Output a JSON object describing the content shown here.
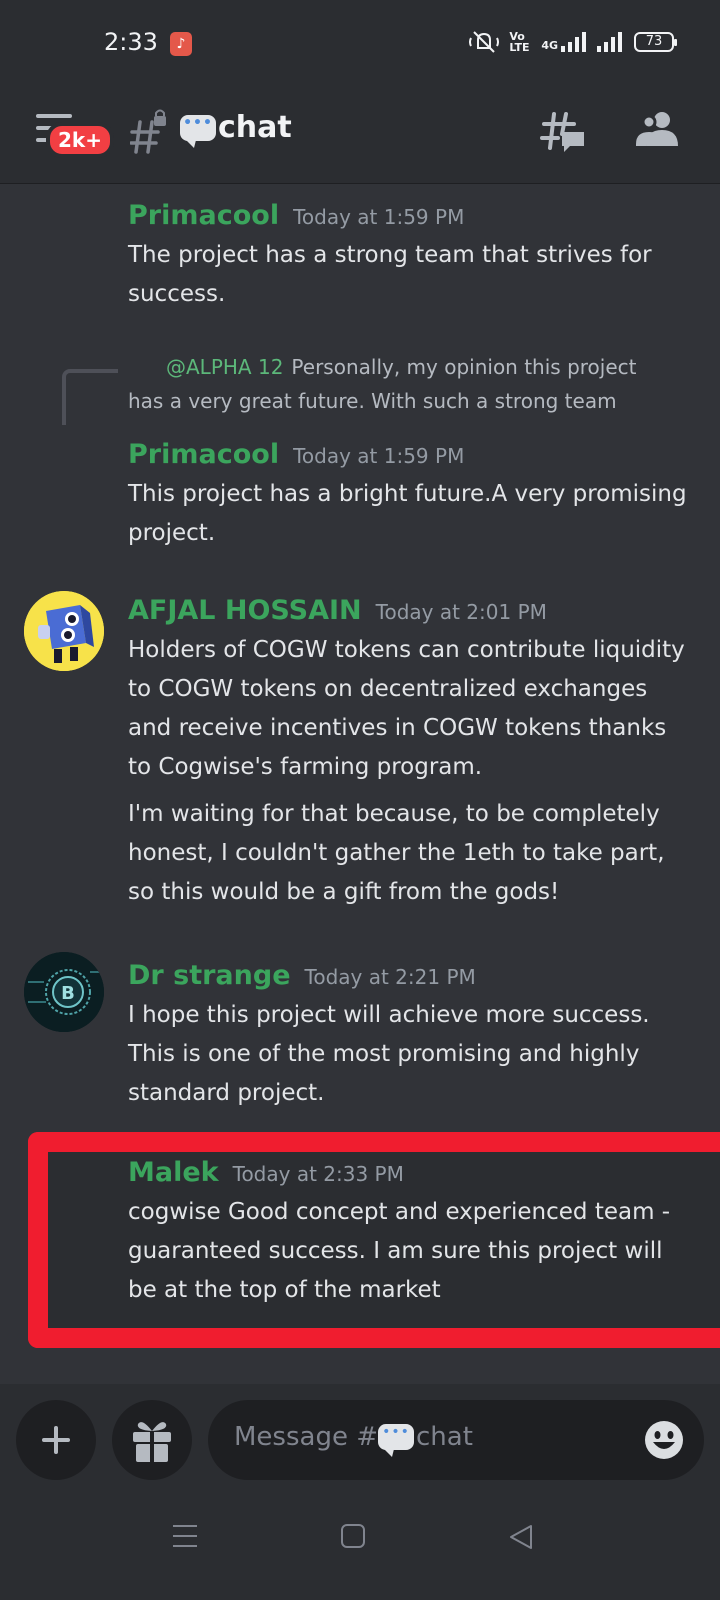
{
  "status_bar": {
    "time": "2:33",
    "network": "4G",
    "volte": "Vo LTE",
    "battery": "73"
  },
  "header": {
    "notification_badge": "2k+",
    "channel_name": "chat"
  },
  "messages": [
    {
      "author": "Primacool",
      "timestamp": "Today at 1:59 PM",
      "text": "The project has a strong team that strives for success."
    },
    {
      "reply_mention": "@ALPHA 12",
      "reply_text_line1": "Personally, my opinion this project",
      "reply_text_line2": "has a very great future. With such a strong team",
      "author": "Primacool",
      "timestamp": "Today at 1:59 PM",
      "text": "This project has a bright future.A very promising project."
    },
    {
      "author": "AFJAL HOSSAIN",
      "timestamp": "Today at 2:01 PM",
      "text": "Holders of COGW tokens can contribute liquidity to COGW tokens on decentralized exchanges and receive incentives in COGW tokens thanks to Cogwise's farming program.",
      "text2": "I'm waiting for that because, to be completely honest, I couldn't gather the 1eth to take part, so this would be a gift from the gods!"
    },
    {
      "author": "Dr strange",
      "timestamp": "Today at 2:21 PM",
      "text": "I hope this project will achieve more success. This is one of the most promising and highly standard project."
    },
    {
      "author": "Malek",
      "timestamp": "Today at 2:33 PM",
      "text": "cogwise Good concept and experienced team - guaranteed success. I am sure this project will be at the top of the market"
    }
  ],
  "composer": {
    "placeholder_prefix": "Message #",
    "placeholder_channel": "chat"
  },
  "colors": {
    "background": "#313338",
    "username_green": "#3ba55d",
    "highlight_red": "#f01d2f",
    "badge_red": "#f23f43"
  },
  "icons": [
    "music-icon",
    "mute-icon",
    "signal-icon",
    "battery-icon",
    "hamburger-icon",
    "locked-hash-icon",
    "speech-bubble-icon",
    "threads-icon",
    "members-icon",
    "plus-icon",
    "gift-icon",
    "emoji-icon",
    "menu-nav-icon",
    "home-nav-icon",
    "back-nav-icon"
  ]
}
